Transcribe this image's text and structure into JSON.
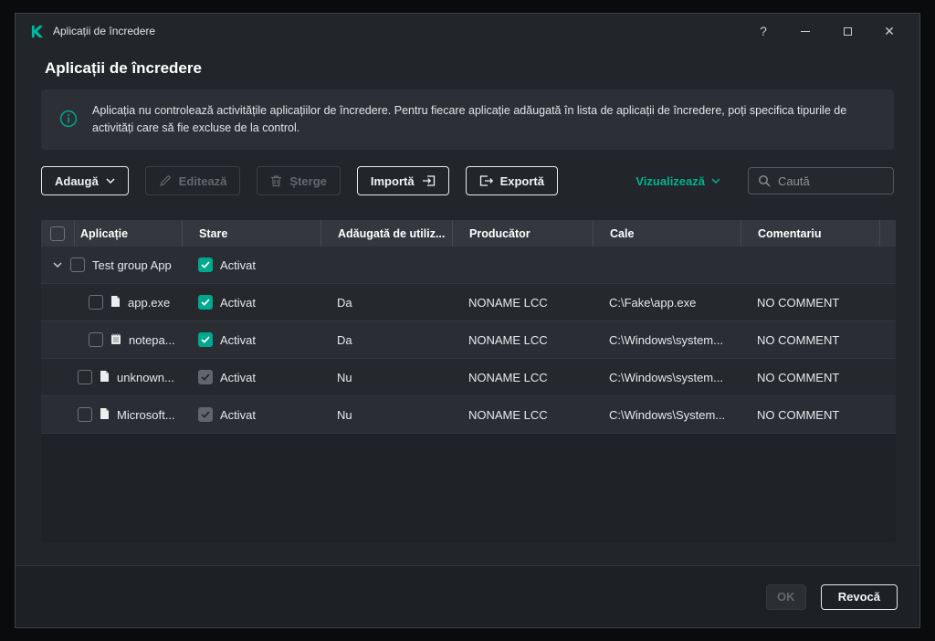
{
  "window": {
    "title": "Aplicații de încredere",
    "help_icon": "?",
    "close_icon": "✕"
  },
  "page": {
    "title": "Aplicații de încredere",
    "info_text": "Aplicația nu controlează activitățile aplicațiilor de încredere. Pentru fiecare aplicație adăugată în lista de aplicații de încredere, poți specifica tipurile de activități care să fie excluse de la control."
  },
  "toolbar": {
    "add_label": "Adaugă",
    "edit_label": "Editează",
    "delete_label": "Șterge",
    "import_label": "Importă",
    "export_label": "Exportă",
    "view_label": "Vizualizează",
    "search_placeholder": "Caută"
  },
  "table": {
    "columns": {
      "application": "Aplicație",
      "state": "Stare",
      "added_by_user": "Adăugată de utiliz...",
      "producer": "Producător",
      "path": "Cale",
      "comment": "Comentariu"
    },
    "rows": [
      {
        "name": "Test group App",
        "status": "Activat",
        "added": "",
        "producer": "",
        "path": "",
        "comment": ""
      },
      {
        "name": "app.exe",
        "status": "Activat",
        "added": "Da",
        "producer": "NONAME LCC",
        "path": "C:\\Fake\\app.exe",
        "comment": "NO COMMENT"
      },
      {
        "name": "notepa...",
        "status": "Activat",
        "added": "Da",
        "producer": "NONAME LCC",
        "path": "C:\\Windows\\system...",
        "comment": "NO COMMENT"
      },
      {
        "name": "unknown...",
        "status": "Activat",
        "added": "Nu",
        "producer": "NONAME LCC",
        "path": "C:\\Windows\\system...",
        "comment": "NO COMMENT"
      },
      {
        "name": "Microsoft...",
        "status": "Activat",
        "added": "Nu",
        "producer": "NONAME LCC",
        "path": "C:\\Windows\\System...",
        "comment": "NO COMMENT"
      }
    ]
  },
  "footer": {
    "ok_label": "OK",
    "cancel_label": "Revocă"
  },
  "colors": {
    "accent": "#00a88e"
  }
}
